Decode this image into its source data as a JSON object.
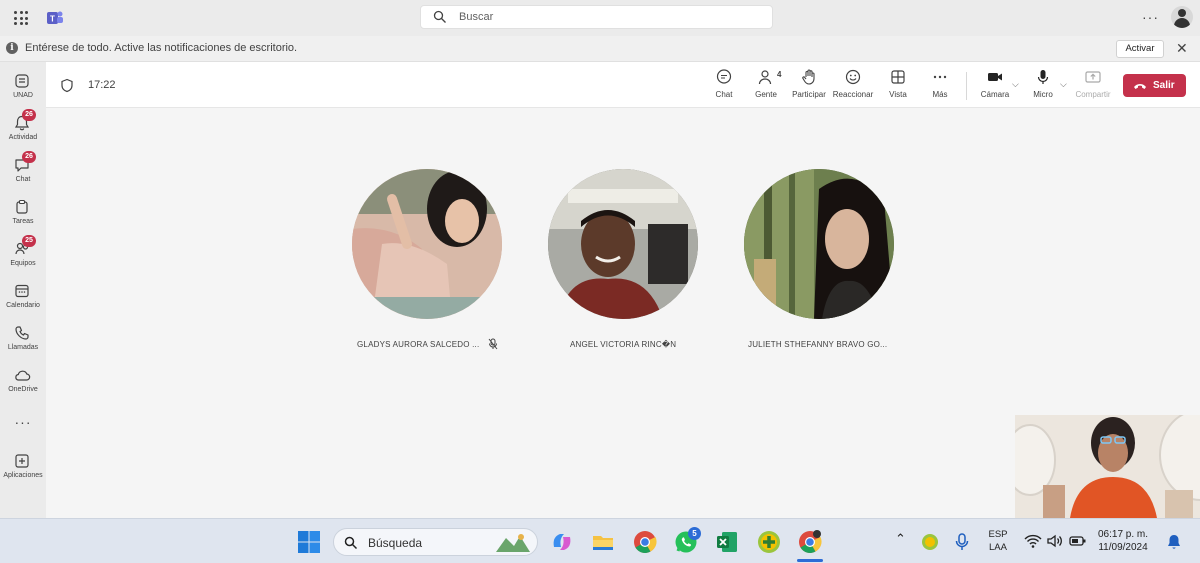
{
  "titlebar": {
    "search_placeholder": "Buscar",
    "more_label": "···"
  },
  "notification": {
    "message": "Entérese de todo. Active las notificaciones de escritorio.",
    "activate_label": "Activar",
    "close_label": "✕"
  },
  "rail": {
    "items": [
      {
        "label": "UNAD",
        "icon": "unad-icon"
      },
      {
        "label": "Actividad",
        "icon": "bell-icon",
        "badge": "26"
      },
      {
        "label": "Chat",
        "icon": "chat-icon",
        "badge": "26"
      },
      {
        "label": "Tareas",
        "icon": "tasks-icon"
      },
      {
        "label": "Equipos",
        "icon": "teams-icon",
        "badge": "25"
      },
      {
        "label": "Calendario",
        "icon": "calendar-icon"
      },
      {
        "label": "Llamadas",
        "icon": "phone-icon"
      },
      {
        "label": "OneDrive",
        "icon": "cloud-icon"
      }
    ],
    "more_label": "···",
    "apps_label": "Aplicaciones"
  },
  "meeting": {
    "timer": "17:22",
    "tools": {
      "chat": "Chat",
      "people": "Gente",
      "people_count": "4",
      "raise": "Participar",
      "react": "Reaccionar",
      "view": "Vista",
      "more": "Más",
      "camera": "Cámara",
      "mic": "Micro",
      "share": "Compartir"
    },
    "leave_label": "Salir"
  },
  "participants": [
    {
      "name": "GLADYS AURORA SALCEDO ...",
      "muted": true
    },
    {
      "name": "ANGEL VICTORIA RINC�N",
      "muted": false
    },
    {
      "name": "JULIETH STHEFANNY BRAVO GO...",
      "muted": false
    }
  ],
  "taskbar": {
    "search_label": "Búsqueda",
    "whatsapp_badge": "5",
    "language_line1": "ESP",
    "language_line2": "LAA",
    "time": "06:17 p. m.",
    "date": "11/09/2024"
  },
  "colors": {
    "leave": "#c4314b",
    "badge": "#c4314b",
    "teams_purple": "#5b5fc7"
  }
}
